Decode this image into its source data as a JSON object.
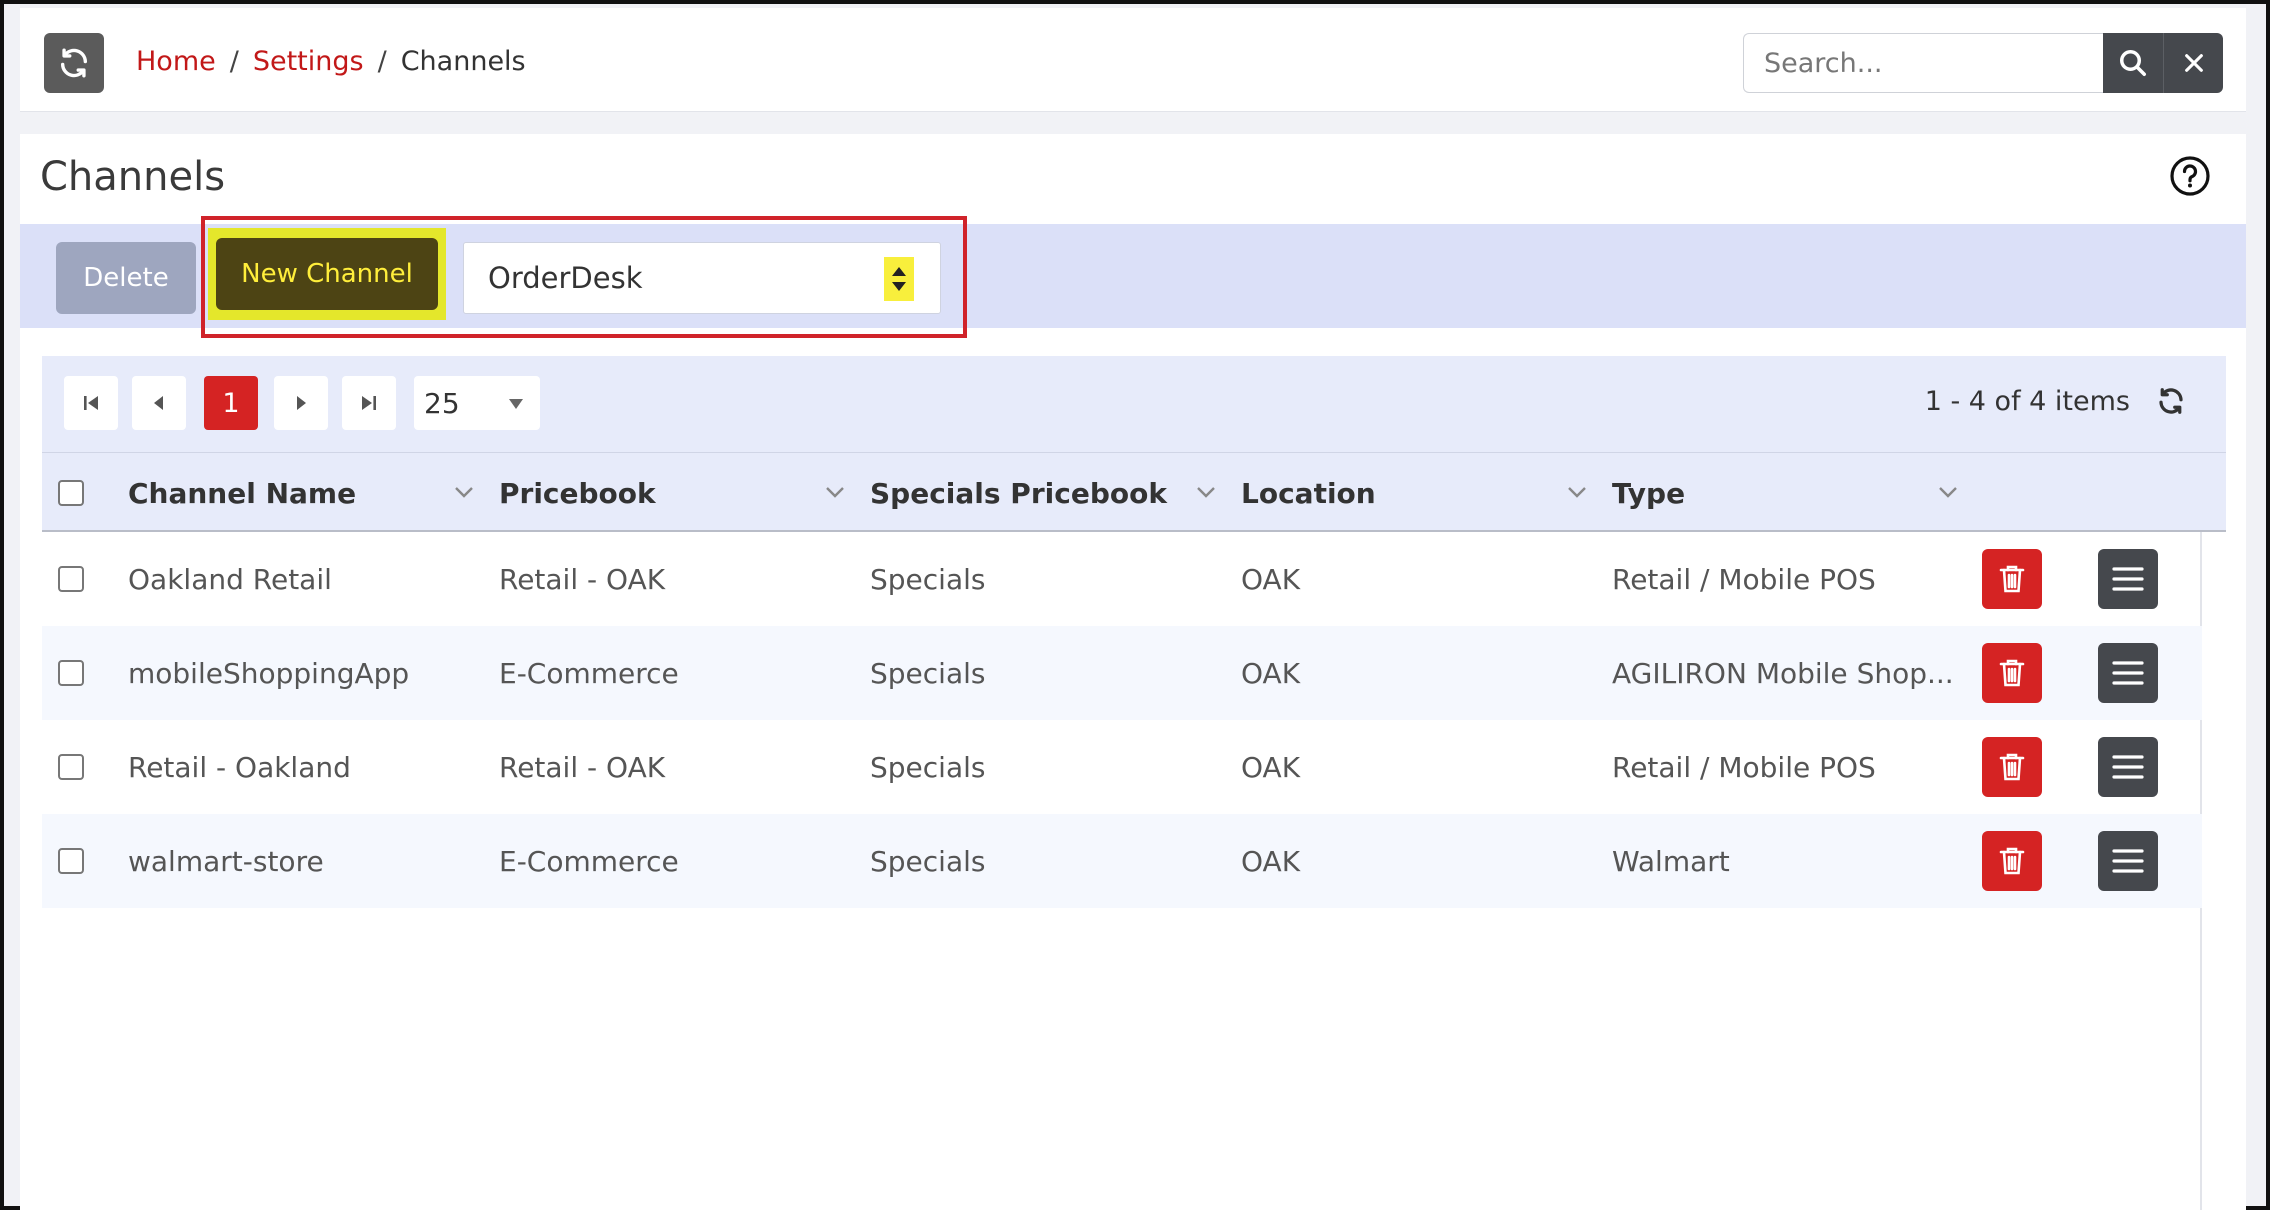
{
  "breadcrumb": {
    "home": "Home",
    "separator": "/",
    "settings": "Settings",
    "current": "Channels"
  },
  "search": {
    "placeholder": "Search...",
    "icon": "search-icon",
    "clear_icon": "close-icon"
  },
  "page": {
    "title": "Channels",
    "help_icon": "question-circle-icon"
  },
  "toolbar": {
    "delete_label": "Delete",
    "new_channel_label": "New Channel",
    "channel_type_selected": "OrderDesk"
  },
  "pager": {
    "current_page": "1",
    "page_size": "25",
    "info": "1 - 4 of 4 items"
  },
  "table": {
    "columns": [
      "Channel Name",
      "Pricebook",
      "Specials Pricebook",
      "Location",
      "Type"
    ],
    "rows": [
      {
        "channel_name": "Oakland Retail",
        "pricebook": "Retail - OAK",
        "specials": "Specials",
        "location": "OAK",
        "type": "Retail / Mobile POS"
      },
      {
        "channel_name": "mobileShoppingApp",
        "pricebook": "E-Commerce",
        "specials": "Specials",
        "location": "OAK",
        "type": "AGILIRON Mobile Shop..."
      },
      {
        "channel_name": "Retail - Oakland",
        "pricebook": "Retail - OAK",
        "specials": "Specials",
        "location": "OAK",
        "type": "Retail / Mobile POS"
      },
      {
        "channel_name": "walmart-store",
        "pricebook": "E-Commerce",
        "specials": "Specials",
        "location": "OAK",
        "type": "Walmart"
      }
    ]
  },
  "colors": {
    "accent_red": "#d52323",
    "link_red": "#c21818",
    "toolbar_bg": "#dbe0f8",
    "highlight_yellow": "#e4e72b",
    "new_channel_bg": "#4d4414",
    "dark_button": "#45484d"
  }
}
